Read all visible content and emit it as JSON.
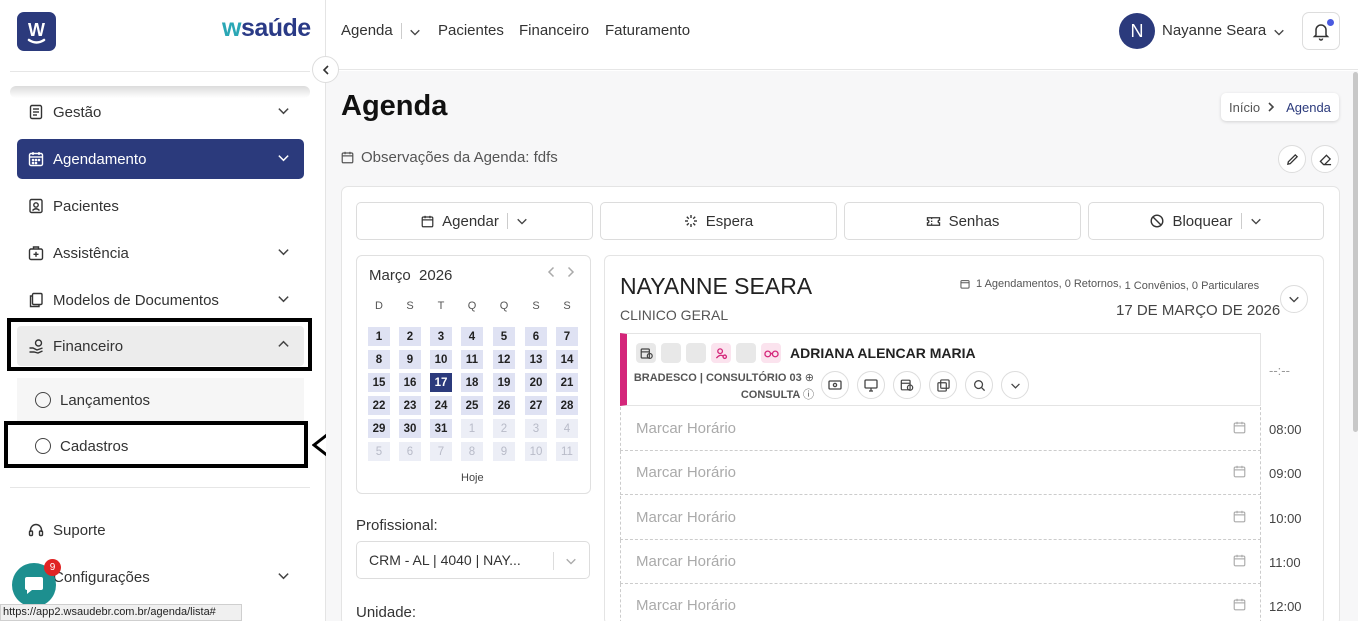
{
  "brand": {
    "logo_letter": "W",
    "name_prefix": "w",
    "name_rest": "saúde"
  },
  "sidebar": {
    "items": [
      {
        "label": "Gestão",
        "icon": "book-icon"
      },
      {
        "label": "Agendamento",
        "icon": "calendar-icon"
      },
      {
        "label": "Pacientes",
        "icon": "patient-card-icon"
      },
      {
        "label": "Assistência",
        "icon": "medical-bag-icon"
      },
      {
        "label": "Modelos de Documentos",
        "icon": "documents-icon"
      },
      {
        "label": "Financeiro",
        "icon": "hand-money-icon"
      }
    ],
    "subitems": [
      {
        "label": "Lançamentos"
      },
      {
        "label": "Cadastros"
      }
    ],
    "footer": [
      {
        "label": "Suporte",
        "icon": "headset-icon"
      },
      {
        "label": "Configurações",
        "icon": "gear-icon"
      }
    ],
    "chat_badge": "9"
  },
  "topnav": {
    "items": [
      "Agenda",
      "Pacientes",
      "Financeiro",
      "Faturamento"
    ]
  },
  "user": {
    "initial": "N",
    "name": "Nayanne Seara"
  },
  "page": {
    "title": "Agenda",
    "breadcrumb": [
      "Início",
      "Agenda"
    ],
    "observations": "Observações da Agenda: fdfs"
  },
  "actions": {
    "agendar": "Agendar",
    "espera": "Espera",
    "senhas": "Senhas",
    "bloquear": "Bloquear"
  },
  "calendar": {
    "month": "Março",
    "year": "2026",
    "weekdays": [
      "D",
      "S",
      "T",
      "Q",
      "Q",
      "S",
      "S"
    ],
    "weeks": [
      [
        "1",
        "2",
        "3",
        "4",
        "5",
        "6",
        "7"
      ],
      [
        "8",
        "9",
        "10",
        "11",
        "12",
        "13",
        "14"
      ],
      [
        "15",
        "16",
        "17",
        "18",
        "19",
        "20",
        "21"
      ],
      [
        "22",
        "23",
        "24",
        "25",
        "26",
        "27",
        "28"
      ],
      [
        "29",
        "30",
        "31",
        "1",
        "2",
        "3",
        "4"
      ],
      [
        "5",
        "6",
        "7",
        "8",
        "9",
        "10",
        "11"
      ]
    ],
    "selected": "17",
    "today_label": "Hoje"
  },
  "filters": {
    "professional_label": "Profissional:",
    "professional_value": "CRM - AL | 4040 | NAY...",
    "unit_label": "Unidade:"
  },
  "schedule": {
    "doctor": "NAYANNE SEARA",
    "specialty": "CLINICO GERAL",
    "summary": {
      "a": "1 Agendamentos,",
      "b": "0 Retornos,",
      "c": "1 Convênios,",
      "d": "0 Particulares"
    },
    "date": "17 DE MARÇO DE 2026",
    "appointment": {
      "patient": "ADRIANA ALENCAR MARIA",
      "insurance": "BRADESCO | CONSULTÓRIO 03",
      "type": "CONSULTA",
      "time": "--:--",
      "accent": "#d4267a"
    },
    "slot_label": "Marcar Horário",
    "times": [
      "08:00",
      "09:00",
      "10:00",
      "11:00",
      "12:00"
    ]
  },
  "status_url": "https://app2.wsaudebr.com.br/agenda/lista#",
  "colors": {
    "primary": "#2b3a7c",
    "accent": "#d4267a",
    "chat": "#1d8f8f"
  }
}
